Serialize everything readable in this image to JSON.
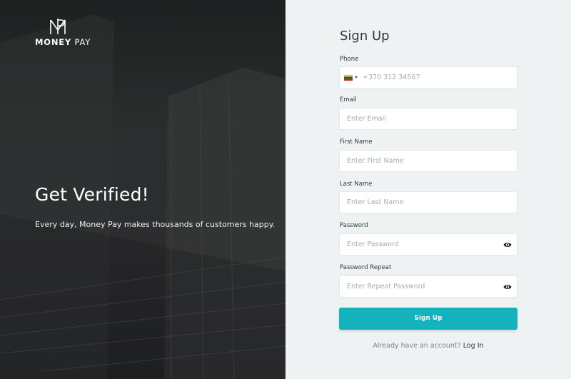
{
  "brand": {
    "name_bold": "MONEY",
    "name_light": "PAY"
  },
  "hero": {
    "title": "Get Verified!",
    "subtitle": "Every day, Money Pay makes thousands of customers happy."
  },
  "form": {
    "title": "Sign Up",
    "phone": {
      "label": "Phone",
      "placeholder": "+370 312 34567",
      "country_flag": "lithuania-flag-icon"
    },
    "email": {
      "label": "Email",
      "placeholder": "Enter Email"
    },
    "first_name": {
      "label": "First Name",
      "placeholder": "Enter First Name"
    },
    "last_name": {
      "label": "Last Name",
      "placeholder": "Enter Last Name"
    },
    "password": {
      "label": "Password",
      "placeholder": "Enter Password"
    },
    "password_repeat": {
      "label": "Password Repeat",
      "placeholder": "Enter Repeat Password"
    },
    "submit_label": "Sign Up",
    "footer_text": "Already have an account?",
    "login_link": "Log In"
  },
  "colors": {
    "accent": "#13b2bd",
    "left_panel": "#2b2d2e",
    "right_panel": "#eef2f3",
    "text_dark": "#2f3b3f"
  }
}
